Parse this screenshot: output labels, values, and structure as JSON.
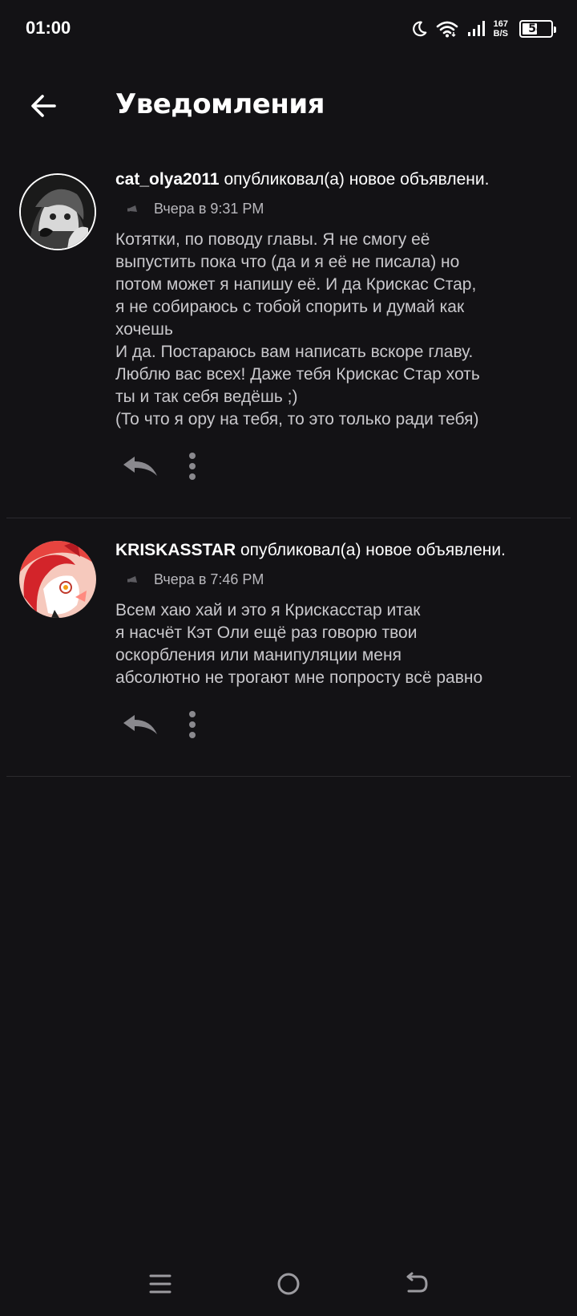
{
  "status_bar": {
    "time": "01:00",
    "net_speed_value": "167",
    "net_speed_unit": "B/S",
    "battery_level": "54",
    "battery_fraction": 0.54,
    "icons": [
      "moon-icon",
      "wifi-icon",
      "signal-icon",
      "battery-icon"
    ]
  },
  "header": {
    "title": "Уведомления"
  },
  "notifications": [
    {
      "username": "cat_olya2011",
      "action": "опубликовал(а) новое объявлени.",
      "time": "Вчера в 9:31 PM",
      "message": "Котятки, по поводу главы. Я не смогу её\nвыпустить пока что (да и я её не писала) но\nпотом может я напишу её. И да Крискас Стар,\nя не собираюсь с тобой спорить и думай как\nхочешь\nИ да. Постараюсь вам написать вскоре главу.\nЛюблю вас всех! Даже тебя Крискас Стар хоть\nты и так себя ведёшь ;)\n(То что я ору на тебя, то это только ради тебя)"
    },
    {
      "username": "KRISKASSTAR",
      "action": "опубликовал(а) новое объявлени.",
      "time": "Вчера в 7:46 PM",
      "message": "Всем хаю хай и это я Крискасстар итак\nя насчёт Кэт Оли ещё раз говорю твои\nоскорбления или манипуляции меня\nабсолютно не трогают мне попросту всё равно"
    }
  ],
  "colors": {
    "background": "#131215",
    "text_primary": "#ffffff",
    "text_secondary": "#c9c8cc",
    "icon_muted": "#8a898e",
    "divider": "#2b2a2e"
  }
}
